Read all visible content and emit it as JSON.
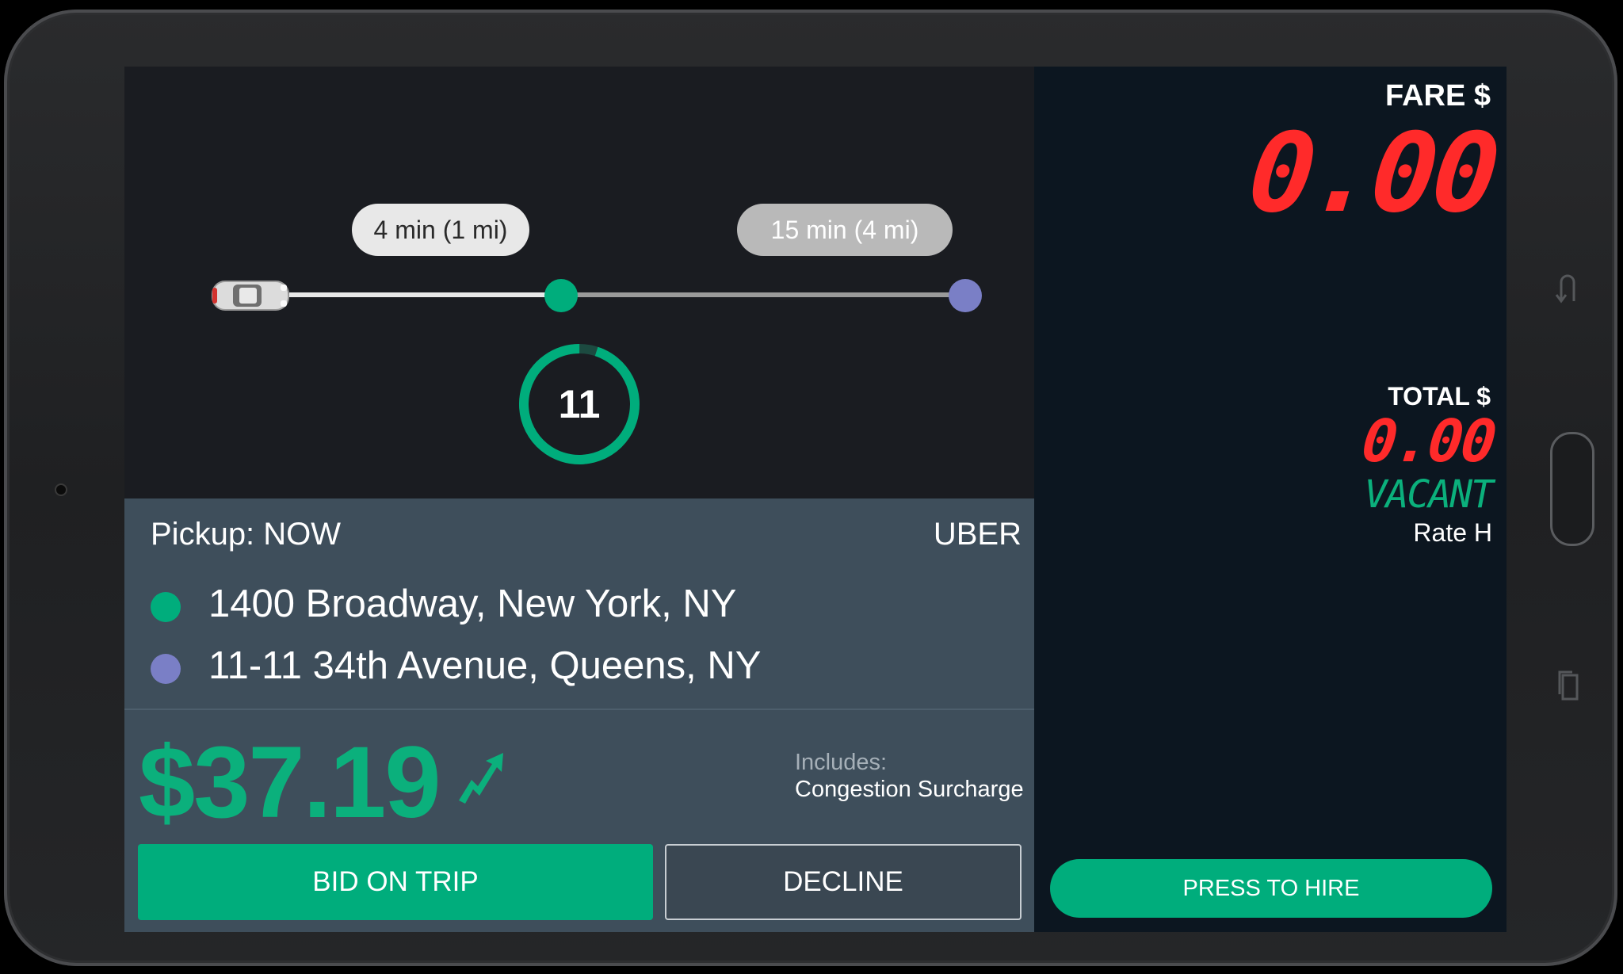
{
  "trip_timeline": {
    "pickup_eta": "4 min (1 mi)",
    "dropoff_eta": "15 min (4 mi)",
    "countdown": "11",
    "countdown_remaining_fraction": 0.95
  },
  "request": {
    "pickup_label": "Pickup: NOW",
    "provider": "UBER",
    "pickup_address": "1400 Broadway, New York, NY",
    "dropoff_address": "11-11 34th Avenue, Queens, NY",
    "price": "$37.19",
    "includes_label": "Includes:",
    "surcharge": "Congestion Surcharge",
    "bid_button": "BID ON TRIP",
    "decline_button": "DECLINE"
  },
  "meter": {
    "fare_label": "FARE $",
    "fare_value": "0.00",
    "total_label": "TOTAL $",
    "total_value": "0.00",
    "status": "VACANT",
    "rate": "Rate H",
    "hire_button": "PRESS TO HIRE"
  },
  "colors": {
    "accent_green": "#00ad7c",
    "dropoff_purple": "#7a7fc6",
    "lcd_red": "#ff2a2a"
  }
}
